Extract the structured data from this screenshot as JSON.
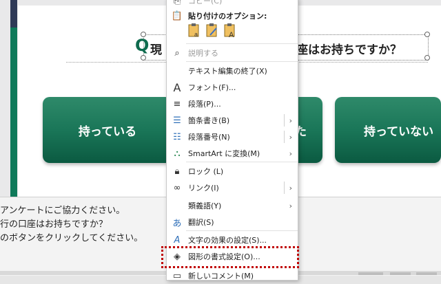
{
  "slide": {
    "title_q": "Q",
    "title_left": "現",
    "title_right": "座はお持ちですか？",
    "answers": [
      "持っている",
      "た",
      "持っていない"
    ]
  },
  "notes": {
    "lines": [
      "アンケートにご協力ください。",
      "行の口座はお持ちですか？",
      "のボタンをクリックしてください。"
    ]
  },
  "context_menu": {
    "top_cut_label": "コピー(C)",
    "paste_options_label": "貼り付けのオプション:",
    "items": [
      {
        "label": "説明する",
        "icon": "search-icon",
        "disabled": true
      },
      {
        "label": "テキスト編集の終了(X)",
        "icon": "",
        "disabled": false
      },
      {
        "label": "フォント(F)...",
        "icon": "font-icon",
        "disabled": false
      },
      {
        "label": "段落(P)...",
        "icon": "paragraph-icon",
        "disabled": false
      },
      {
        "label": "箇条書き(B)",
        "icon": "bullets-icon",
        "submenu": true
      },
      {
        "label": "段落番号(N)",
        "icon": "numbering-icon",
        "submenu": true
      },
      {
        "label": "SmartArt に変換(M)",
        "icon": "smartart-icon",
        "submenu": true
      },
      {
        "label": "ロック (L)",
        "icon": "lock-icon",
        "disabled": false
      },
      {
        "label": "リンク(I)",
        "icon": "link-icon",
        "submenu": true
      },
      {
        "label": "類義語(Y)",
        "icon": "",
        "submenu": true
      },
      {
        "label": "翻訳(S)",
        "icon": "translate-icon",
        "disabled": false
      },
      {
        "label": "文字の効果の設定(S)...",
        "icon": "text-effects-icon",
        "disabled": false
      },
      {
        "label": "図形の書式設定(O)...",
        "icon": "format-shape-icon",
        "disabled": false
      },
      {
        "label": "新しいコメント(M)",
        "icon": "comment-icon",
        "disabled": false
      }
    ]
  },
  "colors": {
    "accent_green": "#0f7a5a",
    "highlight_red": "#c00000"
  }
}
